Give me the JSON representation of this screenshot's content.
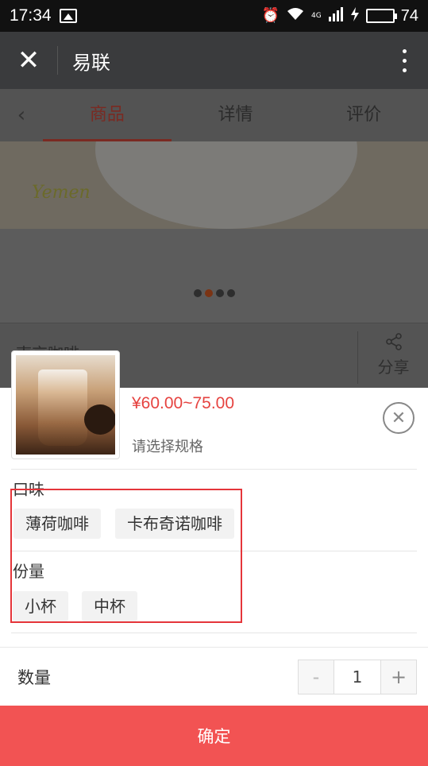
{
  "status_bar": {
    "time": "17:34",
    "network": "4G",
    "battery_level": "74",
    "battery_color": "#27c13a"
  },
  "title_bar": {
    "title": "易联"
  },
  "product_tabs": {
    "items": [
      "商品",
      "详情",
      "评价"
    ],
    "active": "商品",
    "active_color": "#e64340"
  },
  "banner": {
    "logo_text": "Yemen"
  },
  "background_info": {
    "product_name": "南京咖啡",
    "share_label": "分享"
  },
  "sku_sheet": {
    "price": "¥60.00~75.00",
    "price_color": "#e64340",
    "hint": "请选择规格",
    "groups": [
      {
        "label": "口味",
        "options": [
          "薄荷咖啡",
          "卡布奇诺咖啡"
        ]
      },
      {
        "label": "份量",
        "options": [
          "小杯",
          "中杯"
        ]
      }
    ],
    "quantity_label": "数量",
    "quantity_value": "1",
    "minus_label": "-",
    "plus_label": "+",
    "confirm_label": "确定",
    "confirm_color": "#f25353",
    "highlight_color": "#e5353a"
  }
}
